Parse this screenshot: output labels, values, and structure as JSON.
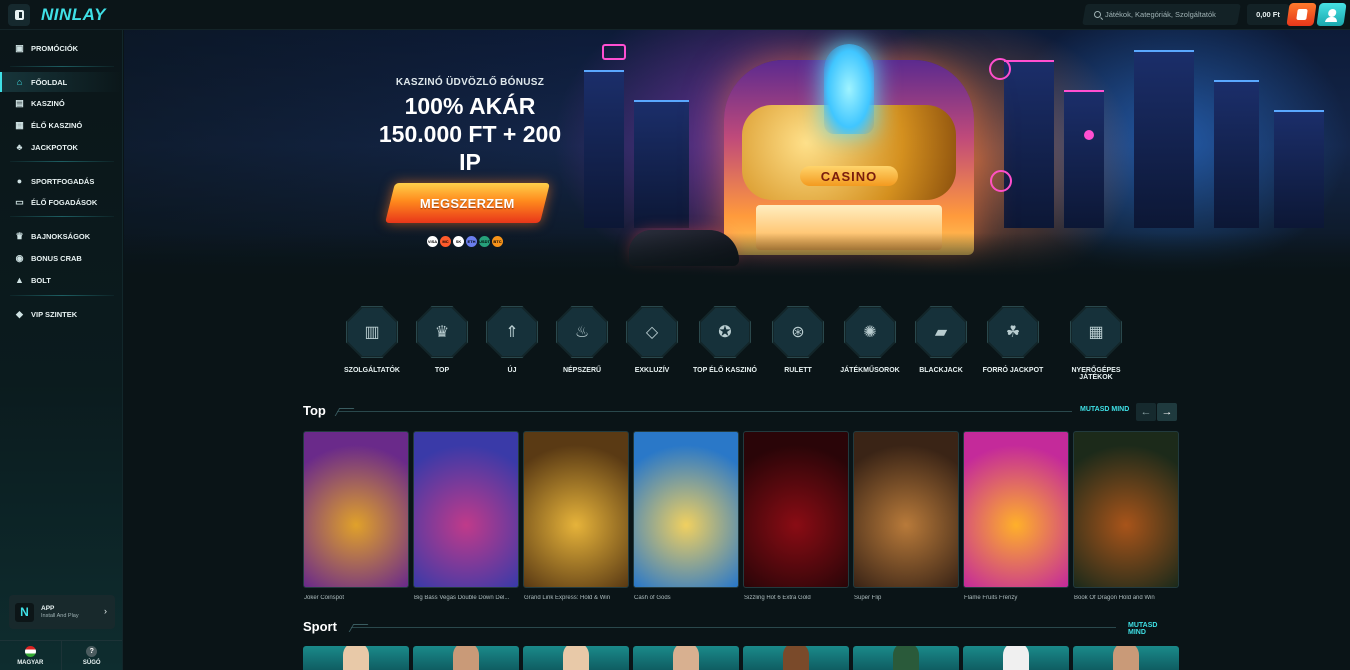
{
  "header": {
    "logo": "NINLAY",
    "search_placeholder": "Játékok, Kategóriák, Szolgáltatók",
    "balance": "0,00 Ft",
    "icons": [
      "sidebar-toggle-icon",
      "search-icon",
      "wallet-icon",
      "user-icon"
    ]
  },
  "sidebar": {
    "items": [
      {
        "label": "Promóciók",
        "icon": "gift-icon"
      },
      {
        "label": "Főoldal",
        "icon": "home-icon",
        "active": true
      },
      {
        "label": "Kaszinó",
        "icon": "slot-icon"
      },
      {
        "label": "Élő kaszinó",
        "icon": "cards-icon"
      },
      {
        "label": "Jackpotok",
        "icon": "clover-icon"
      },
      {
        "label": "Sportfogadás",
        "icon": "ball-icon"
      },
      {
        "label": "Élő fogadások",
        "icon": "live-icon"
      },
      {
        "label": "Bajnokságok",
        "icon": "trophy-icon"
      },
      {
        "label": "Bonus Crab",
        "icon": "crab-icon"
      },
      {
        "label": "Bolt",
        "icon": "bag-icon"
      },
      {
        "label": "VIP szintek",
        "icon": "diamond-icon"
      }
    ],
    "app": {
      "title": "APP",
      "subtitle": "Install And Play",
      "logo": "N"
    },
    "language": "MAGYAR",
    "help": "SÚGÓ"
  },
  "hero": {
    "kicker": "KASZINÓ ÜDVÖZLŐ BÓNUSZ",
    "title_line1": "100% AKÁR",
    "title_line2": "150.000 FT + 200",
    "title_line3": "IP",
    "cta": "MEGSZERZEM",
    "sign": "CASINO",
    "payment_icons": [
      {
        "label": "VISA",
        "color": "#ffffff"
      },
      {
        "label": "MC",
        "color": "#ff5b2b"
      },
      {
        "label": "SK",
        "color": "#ffffff"
      },
      {
        "label": "ETH",
        "color": "#6b7ff0"
      },
      {
        "label": "USDT",
        "color": "#26a17b"
      },
      {
        "label": "BTC",
        "color": "#f7931a"
      }
    ]
  },
  "categories": [
    {
      "label": "SZOLGÁLTATÓK",
      "icon": "book-icon"
    },
    {
      "label": "TOP",
      "icon": "crown-icon"
    },
    {
      "label": "ÚJ",
      "icon": "rocket-icon"
    },
    {
      "label": "NÉPSZERŰ",
      "icon": "fire-icon"
    },
    {
      "label": "EXKLUZÍV",
      "icon": "diamond-icon"
    },
    {
      "label": "TOP ÉLŐ KASZINÓ",
      "icon": "medal-icon"
    },
    {
      "label": "RULETT",
      "icon": "roulette-icon"
    },
    {
      "label": "JÁTÉKMŰSOROK",
      "icon": "wheel-icon"
    },
    {
      "label": "BLACKJACK",
      "icon": "card-icon"
    },
    {
      "label": "FORRÓ JACKPOT",
      "icon": "hot-jackpot-icon"
    },
    {
      "label": "NYERŐGÉPES JÁTÉKOK",
      "icon": "slot-machine-icon"
    }
  ],
  "top_section": {
    "title": "Top",
    "show_all": "MUTASD MIND",
    "games": [
      {
        "name": "Joker Coinspot",
        "art": "Joker",
        "c1": "#6a2a8a",
        "c2": "#e0a12a"
      },
      {
        "name": "Big Bass Vegas Double Down Del...",
        "art": "Big Bass",
        "c1": "#3a3aa8",
        "c2": "#c03a8a"
      },
      {
        "name": "Grand Link Express: Hold & Win",
        "art": "Grand Link",
        "c1": "#5a3a14",
        "c2": "#e6b33a"
      },
      {
        "name": "Cash of Gods",
        "art": "Cash Gods",
        "c1": "#2a78c8",
        "c2": "#f0d060"
      },
      {
        "name": "Sizzling Hot 6 Extra Gold",
        "art": "Sizzling Hot",
        "c1": "#2a0508",
        "c2": "#8a0c14"
      },
      {
        "name": "Super Flip",
        "art": "Super Flip",
        "c1": "#3a2416",
        "c2": "#b87a3a"
      },
      {
        "name": "Flame Fruits Frenzy",
        "art": "Flame Fruits",
        "c1": "#c42a9a",
        "c2": "#ffb02a"
      },
      {
        "name": "Book Of Dragon Hold and Win",
        "art": "Book of Dragon",
        "c1": "#1c2a1a",
        "c2": "#a8541a"
      }
    ]
  },
  "sport_section": {
    "title": "Sport",
    "show_all": "MUTASD MIND",
    "cards": [
      "#e8c9a8",
      "#c99a78",
      "#e8c9a8",
      "#d8b090",
      "#7a4a2a",
      "#2a5a3a",
      "#f0f0f0",
      "#c99a78"
    ]
  }
}
